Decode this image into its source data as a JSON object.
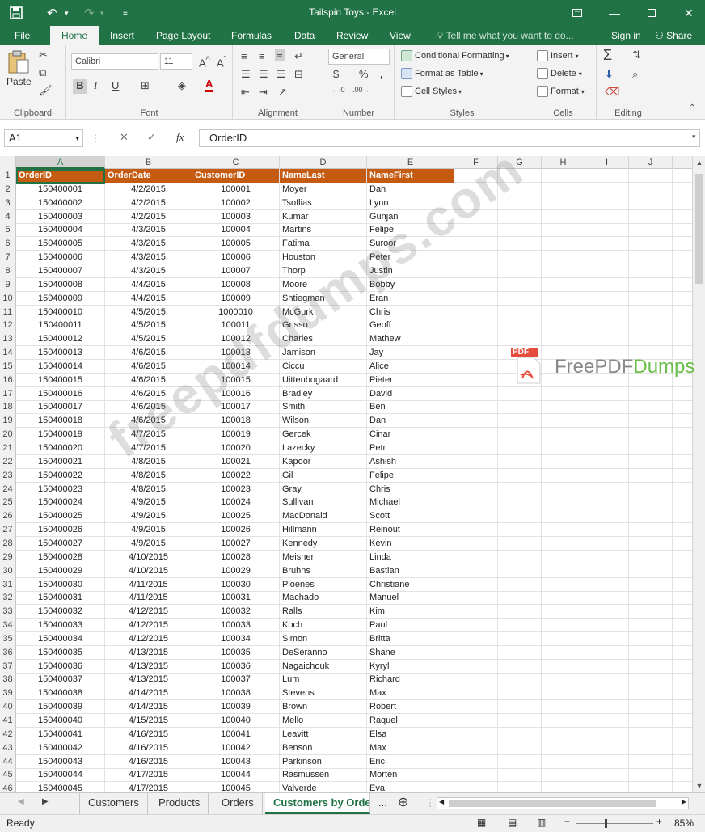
{
  "titlebar": {
    "title": "Tailspin Toys - Excel",
    "save_icon": "save-icon",
    "undo_icon": "undo-icon",
    "redo_icon": "redo-icon"
  },
  "tabs": {
    "file": "File",
    "home": "Home",
    "insert": "Insert",
    "page_layout": "Page Layout",
    "formulas": "Formulas",
    "data": "Data",
    "review": "Review",
    "view": "View",
    "tell_me": "Tell me what you want to do...",
    "sign_in": "Sign in",
    "share": "Share"
  },
  "ribbon": {
    "clipboard": {
      "paste": "Paste",
      "label": "Clipboard"
    },
    "font": {
      "name": "Calibri",
      "size": "11",
      "bold": "B",
      "italic": "I",
      "underline": "U",
      "label": "Font"
    },
    "alignment": {
      "label": "Alignment"
    },
    "number": {
      "format": "General",
      "currency": "$",
      "percent": "%",
      "comma": ",",
      "label": "Number"
    },
    "styles": {
      "conditional": "Conditional Formatting",
      "format_table": "Format as Table",
      "cell_styles": "Cell Styles",
      "label": "Styles"
    },
    "cells": {
      "insert": "Insert",
      "delete": "Delete",
      "format": "Format",
      "label": "Cells"
    },
    "editing": {
      "label": "Editing",
      "sum": "Σ"
    }
  },
  "formula_bar": {
    "name_box": "A1",
    "fx": "fx",
    "content": "OrderID"
  },
  "columns": [
    "A",
    "B",
    "C",
    "D",
    "E",
    "F",
    "G",
    "H",
    "I",
    "J"
  ],
  "headers": [
    "OrderID",
    "OrderDate",
    "CustomerID",
    "NameLast",
    "NameFirst"
  ],
  "rows": [
    [
      "150400001",
      "4/2/2015",
      "100001",
      "Moyer",
      "Dan"
    ],
    [
      "150400002",
      "4/2/2015",
      "100002",
      "Tsoflias",
      "Lynn"
    ],
    [
      "150400003",
      "4/2/2015",
      "100003",
      "Kumar",
      "Gunjan"
    ],
    [
      "150400004",
      "4/3/2015",
      "100004",
      "Martins",
      "Felipe"
    ],
    [
      "150400005",
      "4/3/2015",
      "100005",
      "Fatima",
      "Suroor"
    ],
    [
      "150400006",
      "4/3/2015",
      "100006",
      "Houston",
      "Peter"
    ],
    [
      "150400007",
      "4/3/2015",
      "100007",
      "Thorp",
      "Justin"
    ],
    [
      "150400008",
      "4/4/2015",
      "100008",
      "Moore",
      "Bobby"
    ],
    [
      "150400009",
      "4/4/2015",
      "100009",
      "Shtiegman",
      "Eran"
    ],
    [
      "150400010",
      "4/5/2015",
      "1000010",
      "McGurk",
      "Chris"
    ],
    [
      "150400011",
      "4/5/2015",
      "100011",
      "Grisso",
      "Geoff"
    ],
    [
      "150400012",
      "4/5/2015",
      "100012",
      "Charles",
      "Mathew"
    ],
    [
      "150400013",
      "4/6/2015",
      "100013",
      "Jamison",
      "Jay"
    ],
    [
      "150400014",
      "4/6/2015",
      "100014",
      "Ciccu",
      "Alice"
    ],
    [
      "150400015",
      "4/6/2015",
      "100015",
      "Uittenbogaard",
      "Pieter"
    ],
    [
      "150400016",
      "4/6/2015",
      "100016",
      "Bradley",
      "David"
    ],
    [
      "150400017",
      "4/6/2015",
      "100017",
      "Smith",
      "Ben"
    ],
    [
      "150400018",
      "4/6/2015",
      "100018",
      "Wilson",
      "Dan"
    ],
    [
      "150400019",
      "4/7/2015",
      "100019",
      "Gercek",
      "Cinar"
    ],
    [
      "150400020",
      "4/7/2015",
      "100020",
      "Lazecky",
      "Petr"
    ],
    [
      "150400021",
      "4/8/2015",
      "100021",
      "Kapoor",
      "Ashish"
    ],
    [
      "150400022",
      "4/8/2015",
      "100022",
      "Gil",
      "Felipe"
    ],
    [
      "150400023",
      "4/8/2015",
      "100023",
      "Gray",
      "Chris"
    ],
    [
      "150400024",
      "4/9/2015",
      "100024",
      "Sullivan",
      "Michael"
    ],
    [
      "150400025",
      "4/9/2015",
      "100025",
      "MacDonald",
      "Scott"
    ],
    [
      "150400026",
      "4/9/2015",
      "100026",
      "Hillmann",
      "Reinout"
    ],
    [
      "150400027",
      "4/9/2015",
      "100027",
      "Kennedy",
      "Kevin"
    ],
    [
      "150400028",
      "4/10/2015",
      "100028",
      "Meisner",
      "Linda"
    ],
    [
      "150400029",
      "4/10/2015",
      "100029",
      "Bruhns",
      "Bastian"
    ],
    [
      "150400030",
      "4/11/2015",
      "100030",
      "Ploenes",
      "Christiane"
    ],
    [
      "150400031",
      "4/11/2015",
      "100031",
      "Machado",
      "Manuel"
    ],
    [
      "150400032",
      "4/12/2015",
      "100032",
      "Ralls",
      "Kim"
    ],
    [
      "150400033",
      "4/12/2015",
      "100033",
      "Koch",
      "Paul"
    ],
    [
      "150400034",
      "4/12/2015",
      "100034",
      "Simon",
      "Britta"
    ],
    [
      "150400035",
      "4/13/2015",
      "100035",
      "DeSeranno",
      "Shane"
    ],
    [
      "150400036",
      "4/13/2015",
      "100036",
      "Nagaichouk",
      "Kyryl"
    ],
    [
      "150400037",
      "4/13/2015",
      "100037",
      "Lum",
      "Richard"
    ],
    [
      "150400038",
      "4/14/2015",
      "100038",
      "Stevens",
      "Max"
    ],
    [
      "150400039",
      "4/14/2015",
      "100039",
      "Brown",
      "Robert"
    ],
    [
      "150400040",
      "4/15/2015",
      "100040",
      "Mello",
      "Raquel"
    ],
    [
      "150400041",
      "4/16/2015",
      "100041",
      "Leavitt",
      "Elsa"
    ],
    [
      "150400042",
      "4/16/2015",
      "100042",
      "Benson",
      "Max"
    ],
    [
      "150400043",
      "4/16/2015",
      "100043",
      "Parkinson",
      "Eric"
    ],
    [
      "150400044",
      "4/17/2015",
      "100044",
      "Rasmussen",
      "Morten"
    ],
    [
      "150400045",
      "4/17/2015",
      "100045",
      "Valverde",
      "Eva"
    ]
  ],
  "sheets": {
    "customers": "Customers",
    "products": "Products",
    "orders": "Orders",
    "customers_by_order": "Customers by Orde",
    "more": "...",
    "add": "⊕"
  },
  "status": {
    "ready": "Ready",
    "zoom": "85%"
  },
  "watermarks": {
    "diagonal": "freepdfdumps.com",
    "brand_free": "FreePDF",
    "brand_dumps": "Dumps",
    "pdf_label": "PDF"
  },
  "colors": {
    "excel_green": "#217346",
    "header_orange": "#c55a11"
  }
}
